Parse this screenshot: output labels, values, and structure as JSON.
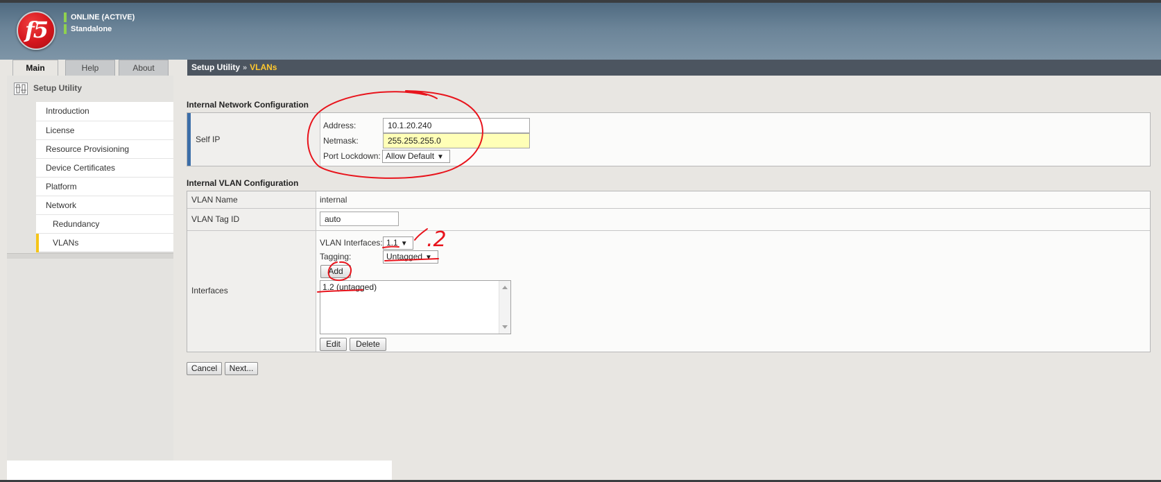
{
  "header": {
    "logo_text": "f5",
    "status_line1": "ONLINE (ACTIVE)",
    "status_line2": "Standalone"
  },
  "tabs": [
    {
      "label": "Main"
    },
    {
      "label": "Help"
    },
    {
      "label": "About"
    }
  ],
  "breadcrumb": {
    "root": "Setup Utility",
    "separator": "»",
    "current": "VLANs"
  },
  "sidebar": {
    "title": "Setup Utility",
    "items": [
      {
        "label": "Introduction"
      },
      {
        "label": "License"
      },
      {
        "label": "Resource Provisioning"
      },
      {
        "label": "Device Certificates"
      },
      {
        "label": "Platform"
      },
      {
        "label": "Network"
      },
      {
        "label": "Redundancy"
      },
      {
        "label": "VLANs"
      }
    ]
  },
  "internal_network": {
    "title": "Internal Network Configuration",
    "row_label": "Self IP",
    "address_label": "Address:",
    "address_value": "10.1.20.240",
    "netmask_label": "Netmask:",
    "netmask_value": "255.255.255.0",
    "port_lockdown_label": "Port Lockdown:",
    "port_lockdown_value": "Allow Default"
  },
  "internal_vlan": {
    "title": "Internal VLAN Configuration",
    "vlan_name_label": "VLAN Name",
    "vlan_name_value": "internal",
    "vlan_tag_label": "VLAN Tag ID",
    "vlan_tag_value": "auto",
    "interfaces_label": "Interfaces",
    "vlan_interfaces_label": "VLAN Interfaces:",
    "vlan_interfaces_value": "1.1",
    "tagging_label": "Tagging:",
    "tagging_value": "Untagged",
    "add_button": "Add",
    "interface_list": [
      "1.2 (untagged)"
    ],
    "edit_button": "Edit",
    "delete_button": "Delete"
  },
  "footer": {
    "cancel_button": "Cancel",
    "next_button": "Next..."
  },
  "annotation": {
    "handwritten_note": ".2",
    "color": "#e8141c"
  },
  "colors": {
    "accent_yellow": "#ffc82e",
    "status_green": "#8fd14f",
    "selection_bar": "#f5c518",
    "self_ip_bar": "#3c6ea8"
  }
}
